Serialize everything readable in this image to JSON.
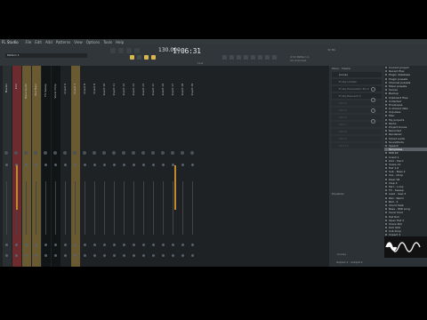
{
  "menubar": {
    "app_title": "FL Studio",
    "items": [
      "File",
      "Edit",
      "Add",
      "Patterns",
      "View",
      "Options",
      "Tools",
      "Help"
    ]
  },
  "toolbar": {
    "pattern_name": "Pattern 1",
    "tempo": "130.000",
    "clock": "1:06:31",
    "hint_line1": "4:32 Pattern 1",
    "hint_line2": "All channels",
    "mode_label": "Line",
    "cpu_label": "32 Mb",
    "snap_label": "Main"
  },
  "mixer": {
    "tracks": [
      {
        "name": "Master",
        "color": "#2a2f32"
      },
      {
        "name": "Kick",
        "color": "#6b2b2f"
      },
      {
        "name": "Bass Synth",
        "color": "#6a5a32"
      },
      {
        "name": "Pad Main",
        "color": "#6a5a32"
      },
      {
        "name": "FX Sweep",
        "color": "#121516"
      },
      {
        "name": "Vocal Chop",
        "color": "#121516"
      },
      {
        "name": "Insert 6",
        "color": "#1e2225"
      },
      {
        "name": "Insert 7",
        "color": "#6a5a32"
      },
      {
        "name": "Insert 8",
        "color": "#1e2225"
      },
      {
        "name": "Insert 9",
        "color": "#1e2225"
      },
      {
        "name": "Insert 10",
        "color": "#1e2225"
      },
      {
        "name": "Insert 11",
        "color": "#1e2225"
      },
      {
        "name": "Insert 12",
        "color": "#1e2225"
      },
      {
        "name": "Insert 13",
        "color": "#1e2225"
      },
      {
        "name": "Insert 14",
        "color": "#1e2225"
      },
      {
        "name": "Insert 15",
        "color": "#1e2225"
      },
      {
        "name": "Insert 16",
        "color": "#1e2225"
      },
      {
        "name": "Insert 17",
        "color": "#1e2225"
      },
      {
        "name": "Insert 18",
        "color": "#1e2225"
      },
      {
        "name": "Insert 19",
        "color": "#1e2225"
      }
    ]
  },
  "effects": {
    "header": "Mixer - Master",
    "preset": "(none)",
    "slots": [
      "Fruity Limiter",
      "Fruity Parametric EQ 2",
      "Fruity Reeverb 2",
      "Slot 4",
      "Slot 5",
      "Slot 6",
      "Slot 7",
      "Slot 8",
      "Slot 9",
      "Slot 10"
    ],
    "equalizer_label": "Equalizer",
    "output_label": "Output 1 - Output 2",
    "input_label": "(none)"
  },
  "browser": {
    "items": [
      "Current project",
      "Recent files",
      "Plugin database",
      "Plugin presets",
      "Channel presets",
      "Mixer presets",
      "Scores",
      "Backup",
      "Clipboard files",
      "Collected",
      "Envelopes",
      "IL shared data",
      "Impulses",
      "Misc",
      "My projects",
      "Packs",
      "Project bones",
      "Recorded",
      "Rendered",
      "Sliced audio",
      "Soundfonts",
      "Speech",
      "Templates",
      "808 Kit",
      "Crash 1",
      "Kick - Hard",
      "Snare 12",
      "Hat 1-6",
      "Sub - Bass 2",
      "Vox - Chop",
      "Riser 08",
      "Clap 4",
      "Perc - Loop",
      "FX - Sweep",
      "Lead - Saw 3",
      "Pad - Warm",
      "Bell - 2",
      "Chord Stab",
      "Bass - 808 Long",
      "Vocal Shot",
      "Hat Roll",
      "Open Hat 2",
      "Snare Roll",
      "Kick 909",
      "Sub Drop",
      "Impact 3",
      "Noise Rise",
      "Vinyl Loop",
      "Tape Stop",
      "Perc 07"
    ],
    "selected_index": 22
  },
  "colors": {
    "accent": "#d6b84e",
    "orange": "#e08a2a",
    "bg": "#262b2e"
  }
}
